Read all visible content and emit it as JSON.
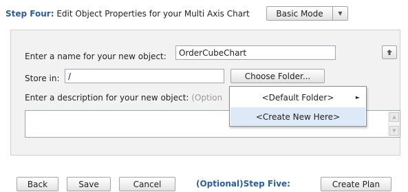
{
  "header": {
    "step_label": "Step Four:",
    "title": "Edit Object Properties for your Multi Axis Chart",
    "mode_button": "Basic Mode",
    "mode_arrow_icon": "chevron-down-icon"
  },
  "form": {
    "name_label": "Enter a name for your new object:",
    "name_value": "OrderCubeChart",
    "store_label": "Store in:",
    "store_value": "/",
    "choose_folder_button": "Choose Folder...",
    "description_label": "Enter a description for your new object:",
    "description_optional": "(Option",
    "description_value": "",
    "up_icon": "up-arrow-icon"
  },
  "folder_menu": {
    "items": [
      {
        "label": "<Default Folder>",
        "has_submenu": true
      },
      {
        "label": "<Create New Here>",
        "has_submenu": false
      }
    ]
  },
  "footer": {
    "back_button": "Back",
    "save_button": "Save",
    "cancel_button": "Cancel",
    "step_five_label": "(Optional)Step Five:",
    "create_plan_button": "Create Plan"
  }
}
